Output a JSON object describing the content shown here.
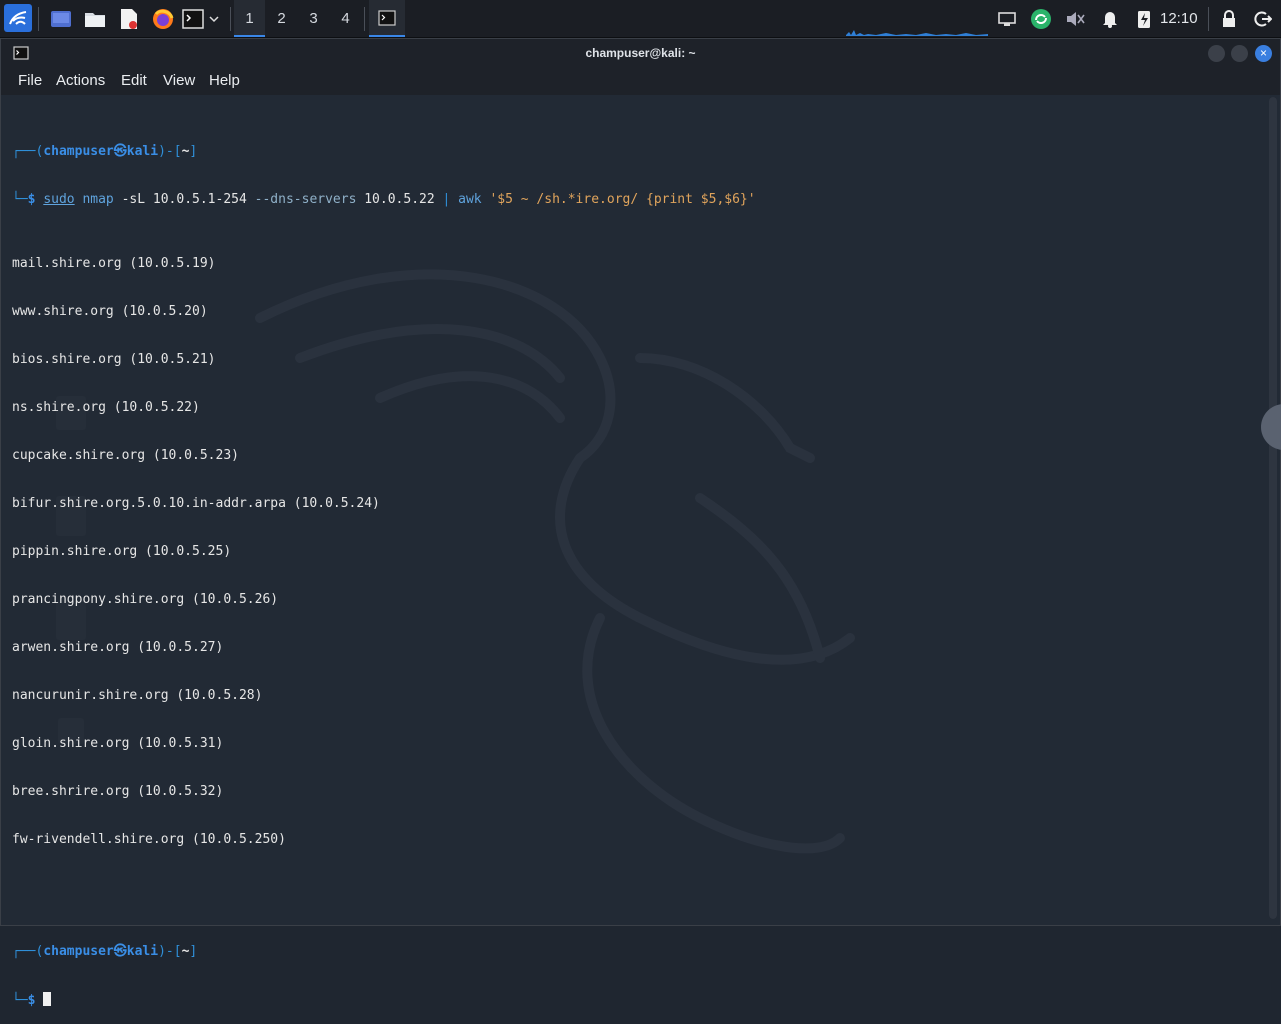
{
  "panel": {
    "workspaces": [
      "1",
      "2",
      "3",
      "4"
    ],
    "active_workspace": 0,
    "clock": "12:10"
  },
  "window": {
    "title": "champuser@kali: ~",
    "close_glyph": "×",
    "menu": [
      "File",
      "Actions",
      "Edit",
      "View",
      "Help"
    ]
  },
  "terminal": {
    "prompt": {
      "open": "┌──(",
      "user": "champuser",
      "at": "㉿",
      "host": "kali",
      "mid": ")-[",
      "dir": "~",
      "close": "]",
      "line2": "└─",
      "dollar": "$"
    },
    "command": {
      "sudo": "sudo",
      "nmap": " nmap",
      "args1": " -sL 10.0.5.1-254 ",
      "opt": "--dns-servers",
      "args2": " 10.0.5.22 ",
      "pipe": "|",
      "awk": " awk ",
      "script": "'$5 ~ /sh.*ire.org/ {print $5,$6}'"
    },
    "output": [
      "mail.shire.org (10.0.5.19)",
      "www.shire.org (10.0.5.20)",
      "bios.shire.org (10.0.5.21)",
      "ns.shire.org (10.0.5.22)",
      "cupcake.shire.org (10.0.5.23)",
      "bifur.shire.org.5.0.10.in-addr.arpa (10.0.5.24)",
      "pippin.shire.org (10.0.5.25)",
      "prancingpony.shire.org (10.0.5.26)",
      "arwen.shire.org (10.0.5.27)",
      "nancurunir.shire.org (10.0.5.28)",
      "gloin.shire.org (10.0.5.31)",
      "bree.shrire.org (10.0.5.32)",
      "fw-rivendell.shire.org (10.0.5.250)"
    ]
  },
  "icons": {
    "panel": [
      "kali-menu-icon",
      "desktop-icon",
      "file-manager-icon",
      "text-editor-icon",
      "firefox-icon",
      "terminal-icon",
      "dropdown-icon",
      "network-icon",
      "update-icon",
      "mute-icon",
      "bell-icon",
      "power-icon",
      "lock-icon",
      "logout-icon"
    ]
  },
  "colors": {
    "accent": "#3a8ee6",
    "terminal_bg": "#222a35",
    "string": "#e0a45c"
  }
}
